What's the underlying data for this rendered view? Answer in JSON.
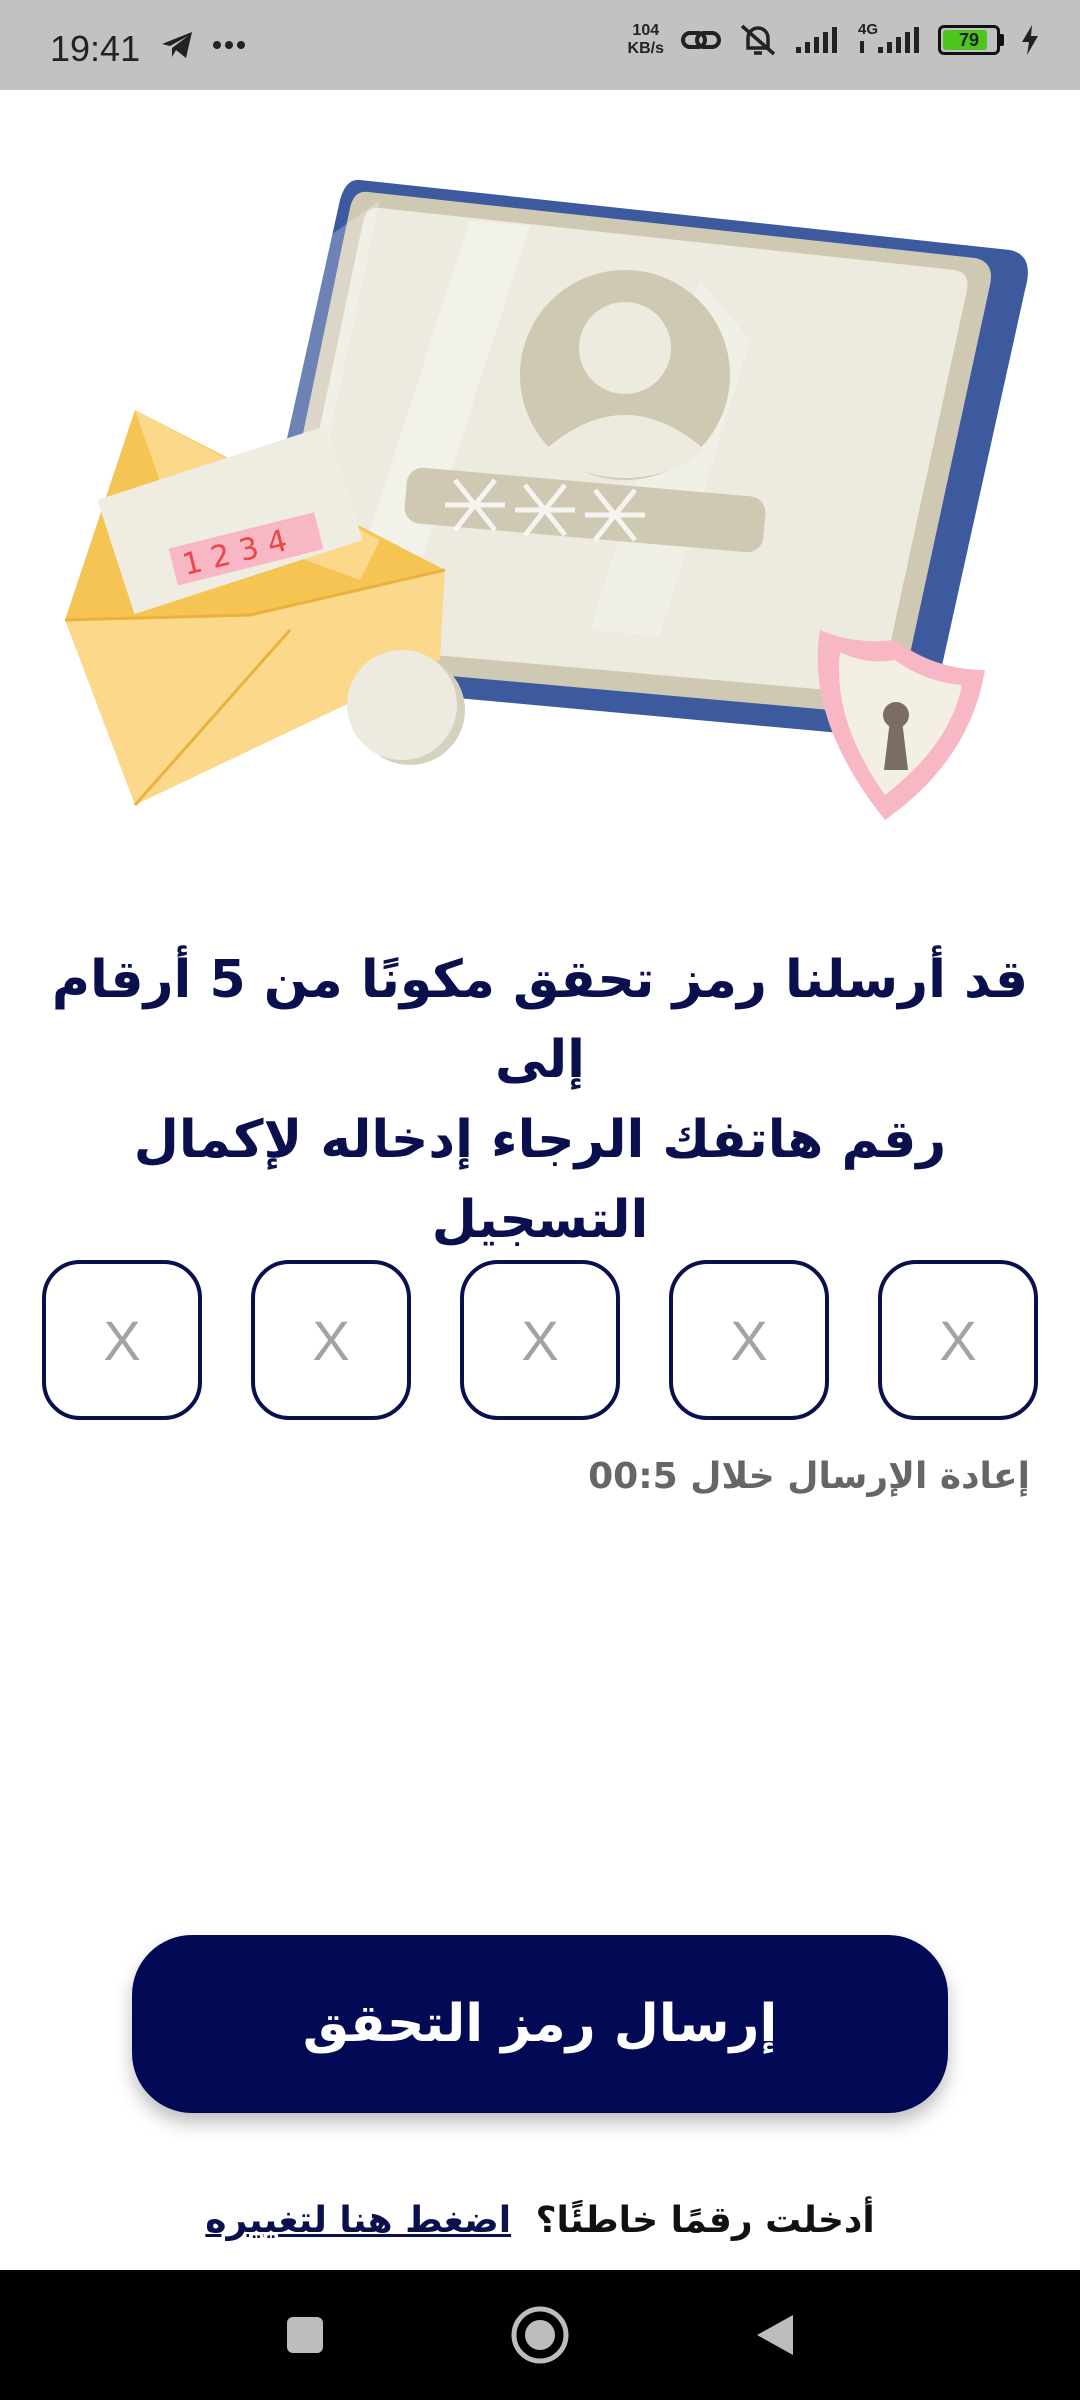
{
  "status_bar": {
    "time": "19:41",
    "network_speed_value": "104",
    "network_speed_unit": "KB/s",
    "network_type": "4G",
    "battery_level": "79",
    "icons": [
      "telegram-icon",
      "more-dots-icon",
      "link-icon",
      "muted-bell-icon",
      "signal-icon",
      "signal-4g-icon",
      "battery-icon",
      "charging-icon"
    ]
  },
  "verification": {
    "heading_line1": "قد أرسلنا رمز تحقق مكونًا من 5 أرقام إلى",
    "heading_line2": "رقم هاتفك الرجاء إدخاله لإكمال التسجيل",
    "code_placeholders": [
      "X",
      "X",
      "X",
      "X",
      "X"
    ],
    "resend_label": "إعادة الإرسال خلال 00:5",
    "submit_label": "إرسال رمز التحقق",
    "wrong_number_text": "أدخلت رقمًا خاطئًا؟",
    "change_link": "اضغط هنا لتغييره"
  },
  "illustration": {
    "envelope_code": "1234"
  },
  "colors": {
    "primary": "#020a55",
    "heading": "#0a0f4d",
    "placeholder": "#a3a3a3"
  }
}
